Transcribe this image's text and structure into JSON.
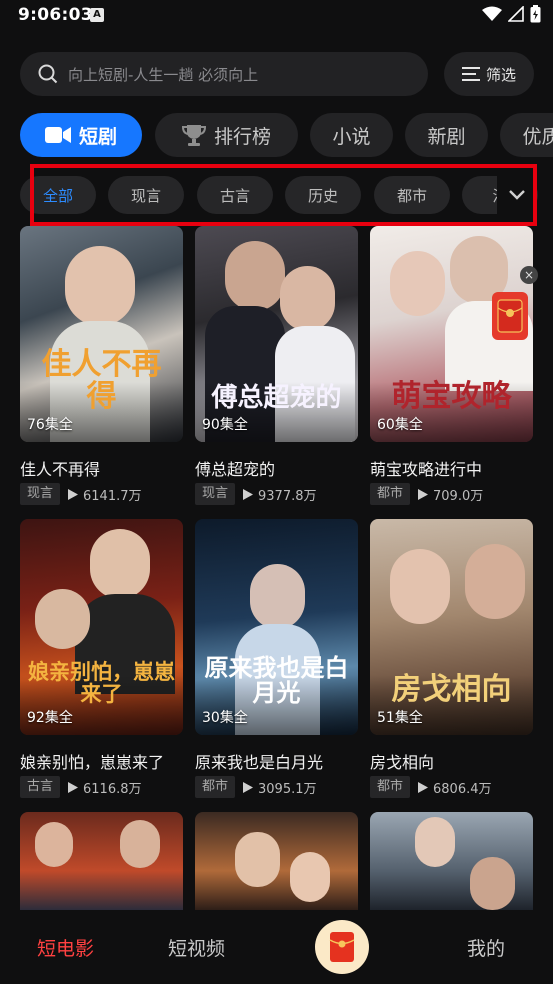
{
  "status": {
    "time": "9:06:03",
    "badge": "A"
  },
  "search": {
    "placeholder": "向上短剧-人生一趟 必须向上",
    "filter_label": "筛选"
  },
  "main_tabs": [
    {
      "label": "短剧"
    },
    {
      "label": "排行榜"
    },
    {
      "label": "小说"
    },
    {
      "label": "新剧"
    },
    {
      "label": "优质"
    }
  ],
  "sub_tabs": [
    {
      "label": "全部"
    },
    {
      "label": "现言"
    },
    {
      "label": "古言"
    },
    {
      "label": "历史"
    },
    {
      "label": "都市"
    },
    {
      "label": "活"
    }
  ],
  "cards": [
    {
      "title": "佳人不再得",
      "art": "佳人不再得",
      "episodes": "76集全",
      "genre": "现言",
      "plays": "6141.7万"
    },
    {
      "title": "傅总超宠的",
      "art": "傅总超宠的",
      "episodes": "90集全",
      "genre": "现言",
      "plays": "9377.8万"
    },
    {
      "title": "萌宝攻略进行中",
      "art": "萌宝攻略",
      "episodes": "60集全",
      "genre": "都市",
      "plays": "709.0万"
    },
    {
      "title": "娘亲别怕，崽崽来了",
      "art": "娘亲别怕，崽崽来了",
      "episodes": "92集全",
      "genre": "古言",
      "plays": "6116.8万"
    },
    {
      "title": "原来我也是白月光",
      "art": "原来我也是白月光",
      "episodes": "30集全",
      "genre": "都市",
      "plays": "3095.1万"
    },
    {
      "title": "房戈相向",
      "art": "房戈相向",
      "episodes": "51集全",
      "genre": "都市",
      "plays": "6806.4万"
    }
  ],
  "bottom_nav": {
    "movies": "短电影",
    "videos": "短视频",
    "mine": "我的"
  },
  "colors": {
    "accent": "#1677ff",
    "active_nav": "#ff4141",
    "highlight": "#e8000f",
    "background": "#0f0f10"
  }
}
